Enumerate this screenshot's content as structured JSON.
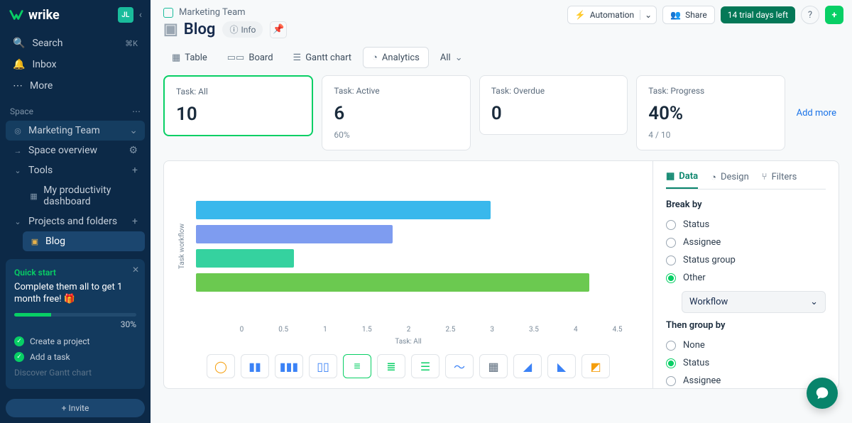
{
  "brand": "wrike",
  "user_initials": "JL",
  "sidebar": {
    "search": {
      "label": "Search",
      "shortcut": "⌘K"
    },
    "inbox": "Inbox",
    "more": "More",
    "space_heading": "Space",
    "space_name": "Marketing Team",
    "overview": "Space overview",
    "tools": "Tools",
    "tool_item": "My productivity dashboard",
    "projects": "Projects and folders",
    "project_item": "Blog"
  },
  "quickstart": {
    "title": "Quick start",
    "subtitle": "Complete them all to get 1 month free! 🎁",
    "percent": "30%",
    "steps": [
      "Create a project",
      "Add a task",
      "Discover Gantt chart"
    ]
  },
  "invite": "Invite",
  "breadcrumb": "Marketing Team",
  "page_title": "Blog",
  "info": "Info",
  "topbar": {
    "automation": "Automation",
    "share": "Share",
    "trial": "14 trial days left"
  },
  "tabs": {
    "table": "Table",
    "board": "Board",
    "gantt": "Gantt chart",
    "analytics": "Analytics",
    "all": "All"
  },
  "cards": [
    {
      "label": "Task: All",
      "value": "10",
      "sub": ""
    },
    {
      "label": "Task: Active",
      "value": "6",
      "sub": "60%"
    },
    {
      "label": "Task: Overdue",
      "value": "0",
      "sub": ""
    },
    {
      "label": "Task: Progress",
      "value": "40%",
      "sub": "4 / 10"
    }
  ],
  "add_more": "Add more",
  "chart_data": {
    "type": "bar",
    "orientation": "horizontal",
    "ylabel": "Task workflow",
    "xlabel": "Task: All",
    "xticks": [
      "0",
      "0.5",
      "1",
      "1.5",
      "2",
      "2.5",
      "3",
      "3.5",
      "4",
      "4.5"
    ],
    "xlim": [
      0,
      4.5
    ],
    "series": [
      {
        "color": "#39b8ec",
        "value": 3.0
      },
      {
        "color": "#7e9cf0",
        "value": 2.0
      },
      {
        "color": "#35d29f",
        "value": 1.0
      },
      {
        "color": "#6bc950",
        "value": 4.0
      }
    ]
  },
  "chart_types": [
    "donut",
    "column",
    "column-grouped",
    "column-stacked",
    "bar-h",
    "bar-h-grouped",
    "bar-h-stacked",
    "line",
    "heatmap",
    "area",
    "area-stacked",
    "area-100"
  ],
  "side_panel": {
    "tabs": {
      "data": "Data",
      "design": "Design",
      "filters": "Filters"
    },
    "break_by": "Break by",
    "break_opts": [
      "Status",
      "Assignee",
      "Status group",
      "Other"
    ],
    "break_sel": "Workflow",
    "then_group": "Then group by",
    "group_opts": [
      "None",
      "Status",
      "Assignee"
    ]
  }
}
